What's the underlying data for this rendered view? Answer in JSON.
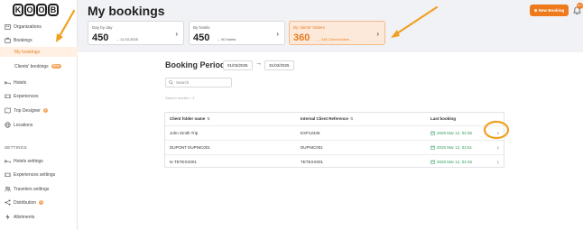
{
  "sidebar": {
    "logo": [
      "K",
      "O",
      "O",
      "B"
    ],
    "items": [
      {
        "label": "Organizations",
        "icon": "building-icon"
      },
      {
        "label": "Bookings",
        "icon": "briefcase-icon"
      },
      {
        "label": "My bookings",
        "active": true
      },
      {
        "label": "Clients' bookings",
        "badge": "Bêta"
      },
      {
        "label": "Hotels",
        "icon": "bed-icon"
      },
      {
        "label": "Experiences",
        "icon": "ticket-icon"
      },
      {
        "label": "Trip Designer",
        "icon": "map-icon",
        "badge": "0"
      },
      {
        "label": "Locations",
        "icon": "globe-icon"
      }
    ],
    "settings_heading": "SETTINGS",
    "settings_items": [
      {
        "label": "Hotels settings",
        "icon": "bed-icon"
      },
      {
        "label": "Experiences settings",
        "icon": "ticket-icon"
      },
      {
        "label": "Travelers settings",
        "icon": "users-icon"
      },
      {
        "label": "Distribution",
        "icon": "share-icon",
        "badge": "0"
      },
      {
        "label": "Allotments",
        "icon": "lightning-icon"
      }
    ]
  },
  "header": {
    "title": "My bookings",
    "new_booking_label": "⊕ New Booking",
    "notification_count": "99+"
  },
  "cards": [
    {
      "label": "Day by day",
      "value": "450",
      "sub": "→ 11.03.2025"
    },
    {
      "label": "By hotels",
      "value": "450",
      "sub": "→ 90 hotels"
    },
    {
      "label": "By clients' folders",
      "value": "360",
      "sub": "→ 345 Client folders",
      "highlighted": true
    }
  ],
  "booking_period": {
    "title": "Booking Period",
    "start": "01/03/2025",
    "end": "31/03/2025"
  },
  "search": {
    "placeholder": "Search",
    "results": "Search results = 3"
  },
  "table": {
    "columns": [
      "Client folder name",
      "Internal Client Reference",
      "Last booking"
    ],
    "rows": [
      {
        "name": "John Smith Trip",
        "ref": "EXP12345",
        "last": "2025 Mar 12, 02:35"
      },
      {
        "name": "DUPONT DUPNIC001",
        "ref": "DUPNIC001",
        "last": "2025 Mar 12, 02:51"
      },
      {
        "name": "te TETEXX001",
        "ref": "TETEXX001",
        "last": "2025 Mar 12, 02:46"
      }
    ]
  },
  "colors": {
    "accent": "#ee7a1d",
    "highlight_bg": "#fde9d9",
    "success": "#2e9e5b",
    "annotation": "#f0a020"
  }
}
